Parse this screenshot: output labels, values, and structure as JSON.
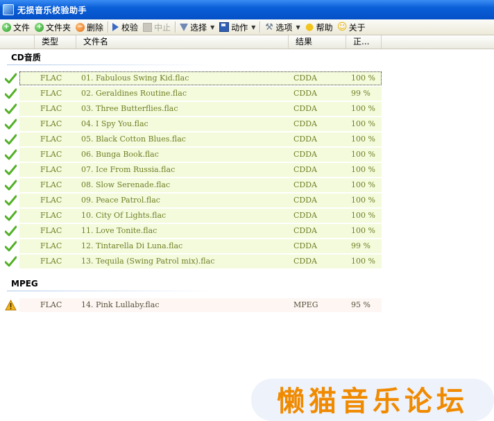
{
  "window": {
    "title": "无损音乐校验助手"
  },
  "toolbar": {
    "items": [
      {
        "label": "文件",
        "icon": "add-icon"
      },
      {
        "label": "文件夹",
        "icon": "add-icon"
      },
      {
        "label": "删除",
        "icon": "delete-icon"
      },
      {
        "label": "校验",
        "icon": "play-icon"
      },
      {
        "label": "中止",
        "icon": "stop-icon"
      },
      {
        "label": "选择",
        "icon": "filter-icon"
      },
      {
        "label": "动作",
        "icon": "save-icon"
      },
      {
        "label": "选项",
        "icon": "wrench-icon"
      },
      {
        "label": "帮助",
        "icon": "bulb-icon"
      },
      {
        "label": "关于",
        "icon": "smile-icon"
      }
    ]
  },
  "columns": {
    "type": "类型",
    "filename": "文件名",
    "result": "结果",
    "percent": "正..."
  },
  "groups": [
    {
      "title": "CD音质",
      "rows": [
        {
          "type": "FLAC",
          "name": "01. Fabulous Swing Kid.flac",
          "result": "CDDA",
          "percent": "100 %"
        },
        {
          "type": "FLAC",
          "name": "02. Geraldines Routine.flac",
          "result": "CDDA",
          "percent": "99 %"
        },
        {
          "type": "FLAC",
          "name": "03. Three Butterflies.flac",
          "result": "CDDA",
          "percent": "100 %"
        },
        {
          "type": "FLAC",
          "name": "04. I Spy You.flac",
          "result": "CDDA",
          "percent": "100 %"
        },
        {
          "type": "FLAC",
          "name": "05. Black Cotton Blues.flac",
          "result": "CDDA",
          "percent": "100 %"
        },
        {
          "type": "FLAC",
          "name": "06. Bunga Book.flac",
          "result": "CDDA",
          "percent": "100 %"
        },
        {
          "type": "FLAC",
          "name": "07. Ice From Russia.flac",
          "result": "CDDA",
          "percent": "100 %"
        },
        {
          "type": "FLAC",
          "name": "08. Slow Serenade.flac",
          "result": "CDDA",
          "percent": "100 %"
        },
        {
          "type": "FLAC",
          "name": "09. Peace Patrol.flac",
          "result": "CDDA",
          "percent": "100 %"
        },
        {
          "type": "FLAC",
          "name": "10. City Of Lights.flac",
          "result": "CDDA",
          "percent": "100 %"
        },
        {
          "type": "FLAC",
          "name": "11. Love Tonite.flac",
          "result": "CDDA",
          "percent": "100 %"
        },
        {
          "type": "FLAC",
          "name": "12. Tintarella Di Luna.flac",
          "result": "CDDA",
          "percent": "99 %"
        },
        {
          "type": "FLAC",
          "name": "13. Tequila (Swing Patrol mix).flac",
          "result": "CDDA",
          "percent": "100 %"
        }
      ]
    },
    {
      "title": "MPEG",
      "rows": [
        {
          "type": "FLAC",
          "name": "14. Pink Lullaby.flac",
          "result": "MPEG",
          "percent": "95 %"
        }
      ]
    }
  ],
  "watermark": {
    "text": "懒猫音乐论坛"
  },
  "colors": {
    "titlebar": "#0a5fd8",
    "row_ok_bg": "#f3fbdc",
    "row_warn_bg": "#fdf6f3",
    "row_text": "#6f7f26",
    "watermark": "#f08a00"
  }
}
